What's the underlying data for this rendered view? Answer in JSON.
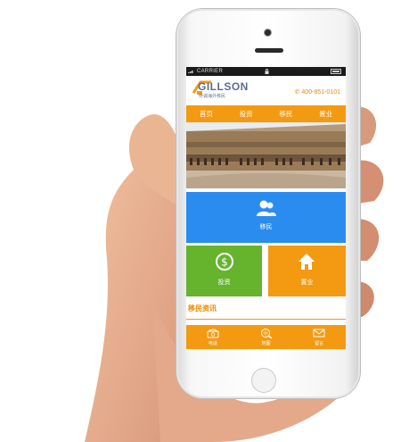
{
  "status_bar": {
    "carrier": "CARRIER"
  },
  "header": {
    "brand": "GILLSON",
    "tagline": "侨诚海外移民",
    "phone": "400-851-0101"
  },
  "nav": {
    "items": [
      "首页",
      "投资",
      "移民",
      "置业"
    ]
  },
  "tiles": {
    "immigration_label": "移民",
    "investment_label": "投资",
    "property_label": "置业"
  },
  "section": {
    "title": "移民资讯"
  },
  "footer": {
    "items": [
      "电话",
      "地图",
      "留言"
    ]
  },
  "colors": {
    "accent": "#f39a12",
    "blue": "#2b8cf0",
    "green": "#66b32e"
  }
}
